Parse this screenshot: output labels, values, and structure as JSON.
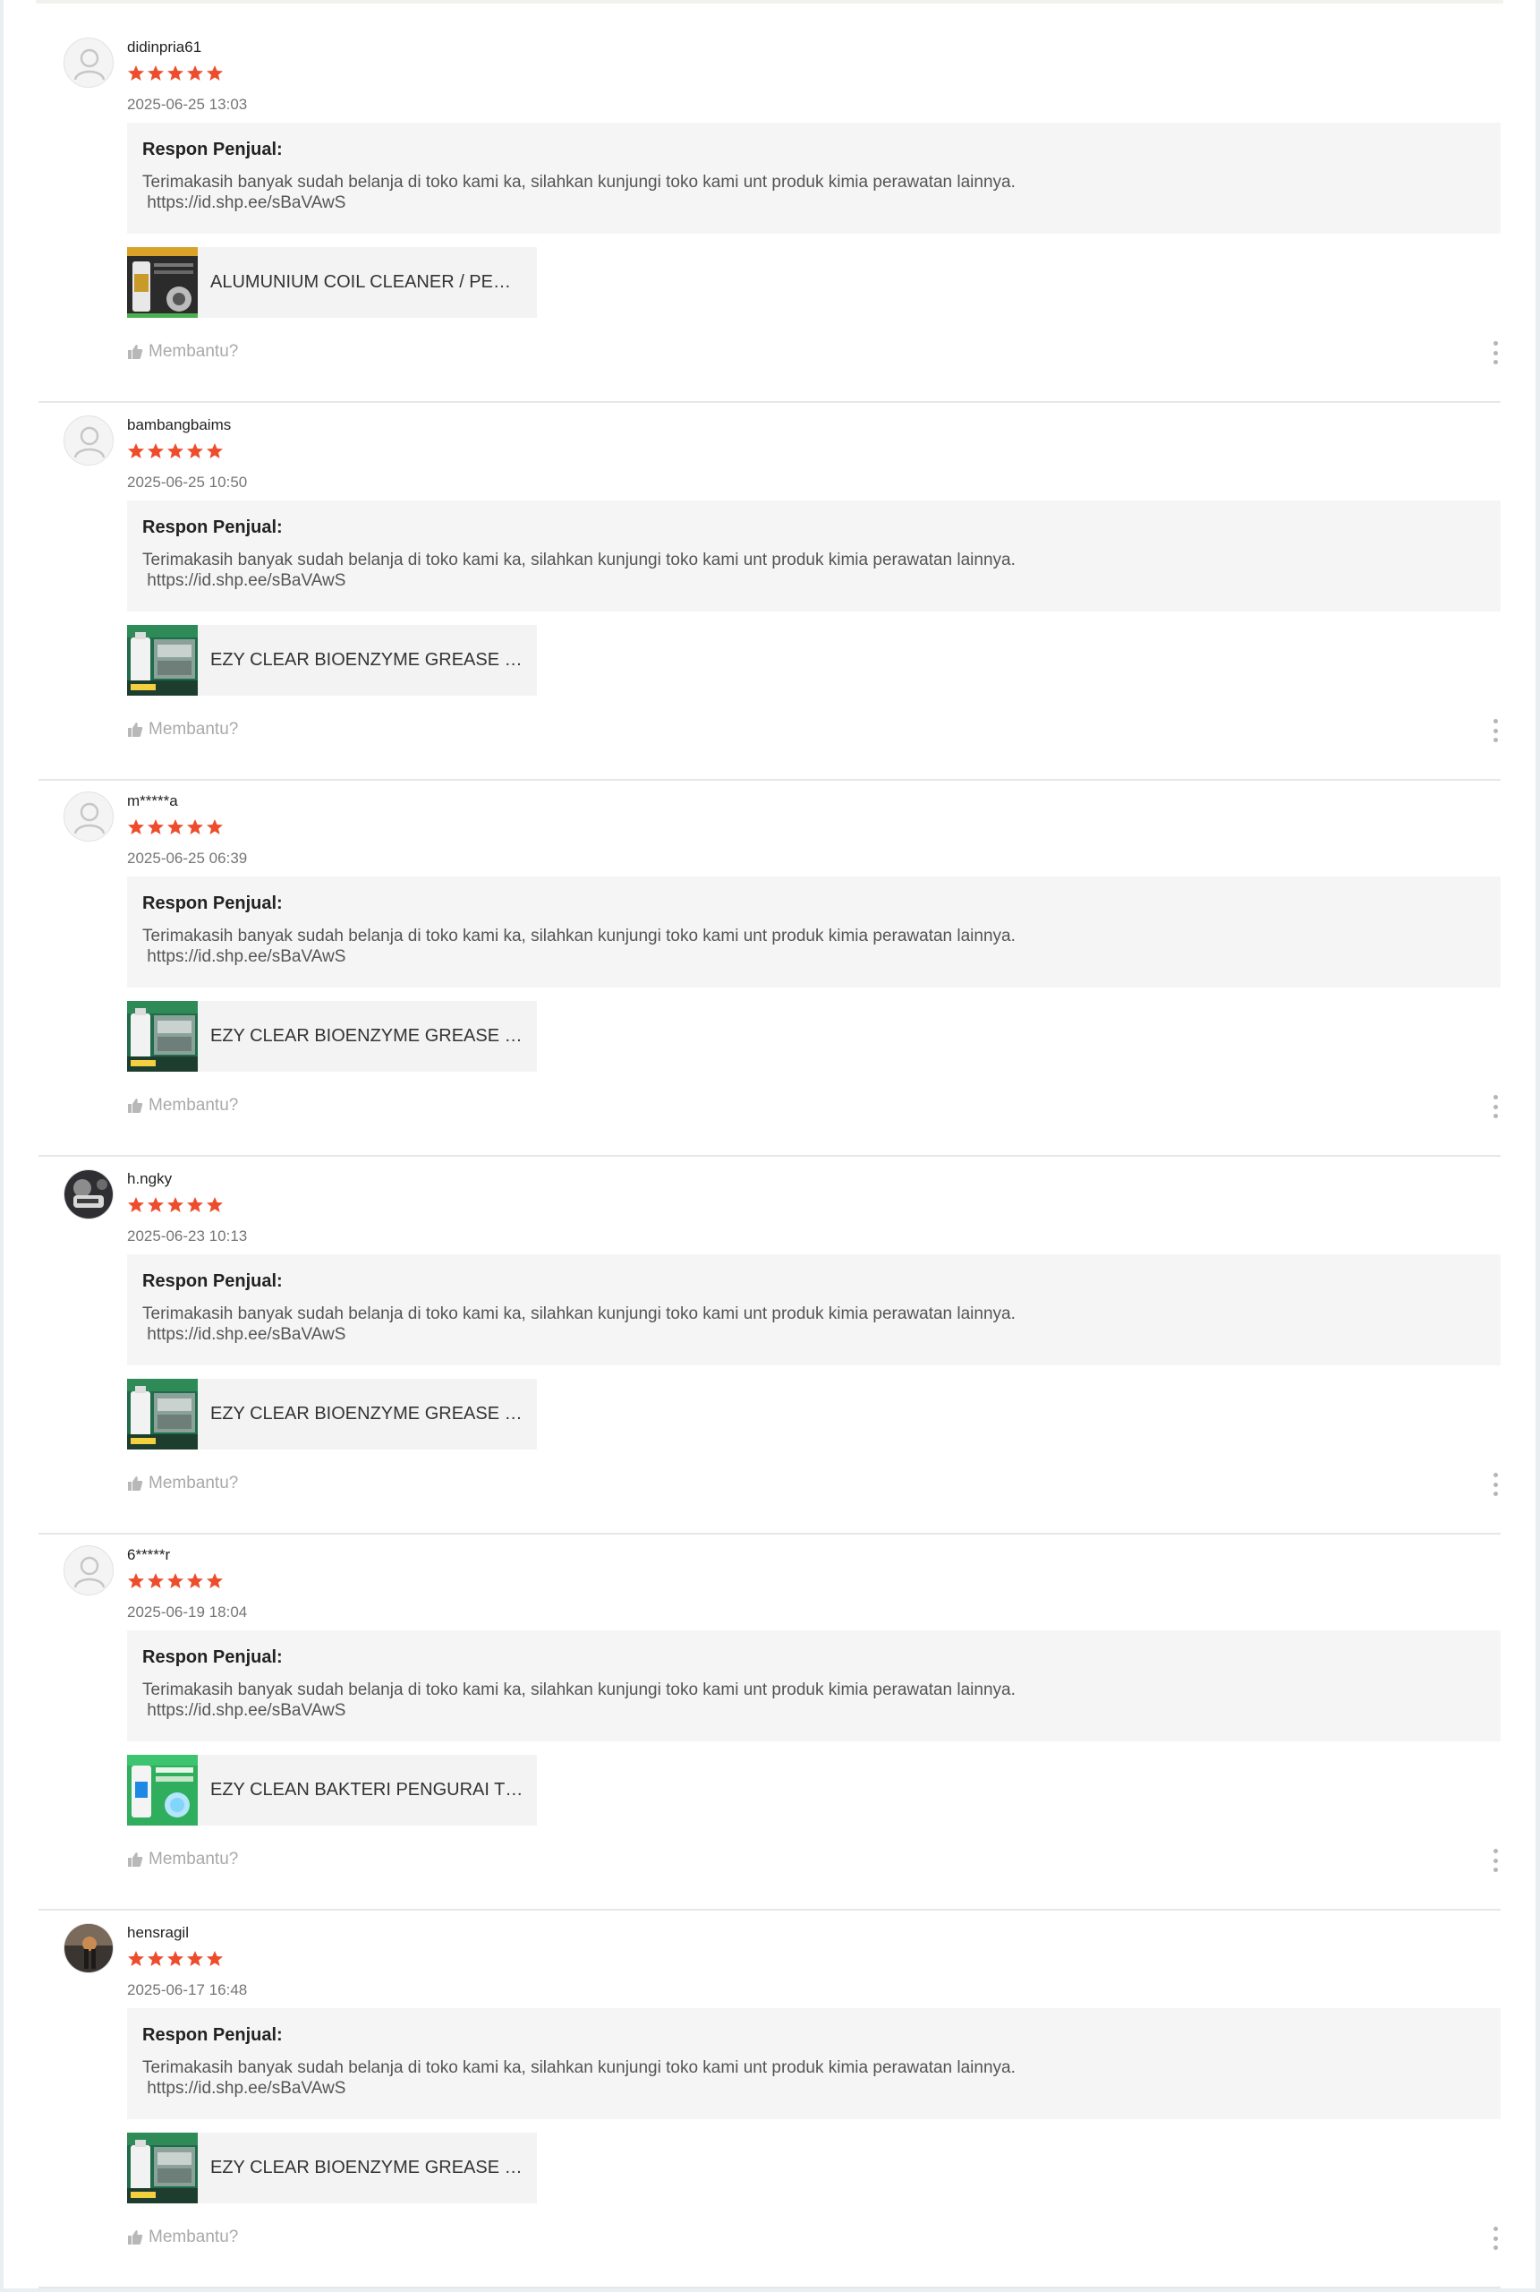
{
  "colors": {
    "star": "#ee4d2d",
    "response_bg": "#f5f5f5",
    "divider": "#e7e7e7"
  },
  "reviews": [
    {
      "username": "didinpria61",
      "avatar": "default-user-icon",
      "rating": 5,
      "date": "2025-06-25 13:03",
      "response_title": "Respon Penjual:",
      "response_text": "Terimakasih banyak sudah belanja di toko kami ka, silahkan kunjungi toko kami unt produk kimia perawatan lainnya.\n https://id.shp.ee/sBaVAwS",
      "product_name": "ALUMUNIUM COIL CLEANER / PEMBERSIH AC",
      "product_thumb": "coil-cleaner-product-image",
      "helpful_label": "Membantu?"
    },
    {
      "username": "bambangbaims",
      "avatar": "default-user-icon",
      "rating": 5,
      "date": "2025-06-25 10:50",
      "response_title": "Respon Penjual:",
      "response_text": "Terimakasih banyak sudah belanja di toko kami ka, silahkan kunjungi toko kami unt produk kimia perawatan lainnya.\n https://id.shp.ee/sBaVAwS",
      "product_name": "EZY CLEAR BIOENZYME GREASE EATER",
      "product_thumb": "grease-eater-product-image",
      "helpful_label": "Membantu?"
    },
    {
      "username": "m*****a",
      "avatar": "default-user-icon",
      "rating": 5,
      "date": "2025-06-25 06:39",
      "response_title": "Respon Penjual:",
      "response_text": "Terimakasih banyak sudah belanja di toko kami ka, silahkan kunjungi toko kami unt produk kimia perawatan lainnya.\n https://id.shp.ee/sBaVAwS",
      "product_name": "EZY CLEAR BIOENZYME GREASE EATER",
      "product_thumb": "grease-eater-product-image",
      "helpful_label": "Membantu?"
    },
    {
      "username": "h.ngky",
      "avatar": "user-photo-avatar",
      "rating": 5,
      "date": "2025-06-23 10:13",
      "response_title": "Respon Penjual:",
      "response_text": "Terimakasih banyak sudah belanja di toko kami ka, silahkan kunjungi toko kami unt produk kimia perawatan lainnya.\n https://id.shp.ee/sBaVAwS",
      "product_name": "EZY CLEAR BIOENZYME GREASE EATER",
      "product_thumb": "grease-eater-product-image",
      "helpful_label": "Membantu?"
    },
    {
      "username": "6*****r",
      "avatar": "default-user-icon",
      "rating": 5,
      "date": "2025-06-19 18:04",
      "response_title": "Respon Penjual:",
      "response_text": "Terimakasih banyak sudah belanja di toko kami ka, silahkan kunjungi toko kami unt produk kimia perawatan lainnya.\n https://id.shp.ee/sBaVAwS",
      "product_name": "EZY CLEAN BAKTERI PENGURAI TINJA",
      "product_thumb": "bacteria-product-image",
      "helpful_label": "Membantu?"
    },
    {
      "username": "hensragil",
      "avatar": "user-photo-avatar",
      "rating": 5,
      "date": "2025-06-17 16:48",
      "response_title": "Respon Penjual:",
      "response_text": "Terimakasih banyak sudah belanja di toko kami ka, silahkan kunjungi toko kami unt produk kimia perawatan lainnya.\n https://id.shp.ee/sBaVAwS",
      "product_name": "EZY CLEAR BIOENZYME GREASE EATER",
      "product_thumb": "grease-eater-product-image",
      "helpful_label": "Membantu?"
    }
  ]
}
